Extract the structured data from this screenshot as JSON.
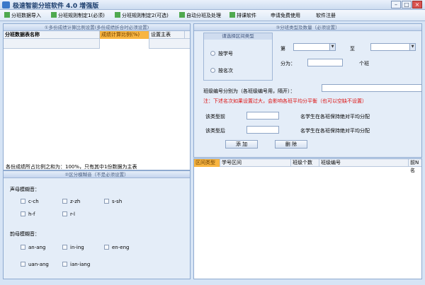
{
  "window": {
    "title": "极速智能分班软件 4.0 增强版"
  },
  "toolbar": {
    "items": [
      "分班数据导入",
      "分班规则制定1(必须)",
      "分班规则制定2(可选)",
      "自动分班及处理",
      "排课软件",
      "申请免费使用",
      "软件注册"
    ]
  },
  "left_top": {
    "header": "①多份成绩计算比例设置(多份成绩折合时必须设置)",
    "columns": [
      "分班数据表名称",
      "成绩计算比例(%)",
      "设置主表"
    ],
    "footer": "各份成绩所占比例之和为：100%，只有其中1份数据为主表"
  },
  "left_bottom": {
    "header": "②区分模糊音（不是必须设置）",
    "shengmu_label": "声母模糊音：",
    "shengmu": [
      "c-ch",
      "z-zh",
      "s-sh",
      "h-f",
      "r-l"
    ],
    "yunmu_label": "韵母模糊音：",
    "yunmu": [
      "an-ang",
      "in-ing",
      "en-eng",
      "uan-ang",
      "ian-iang"
    ]
  },
  "right_top": {
    "header": "③分班类型及数量（必须设置）",
    "group_title": "请选择区间类型",
    "radio1": "按学号",
    "radio2": "按名次",
    "di_label": "第",
    "zhi_label": "至",
    "fenwei_label": "分为：",
    "ge_ban_label": "个班",
    "banhao_label": "班级编号分别为（各班级编号用，隔开）：",
    "note": "注：下述名次如果设置过大，会影响各班平均分平衡（也可以空缺不设置）",
    "before_label": "该类型前",
    "before_text": "名学生在各班保持绝对平均分配",
    "after_label": "该类型后",
    "after_text": "名学生在各班保持绝对平均分配",
    "add_button": "添 加",
    "delete_button": "删 除"
  },
  "right_grid": {
    "columns": [
      "区间类型",
      "学号区间",
      "班级个数",
      "班级编号",
      "前N名"
    ]
  }
}
